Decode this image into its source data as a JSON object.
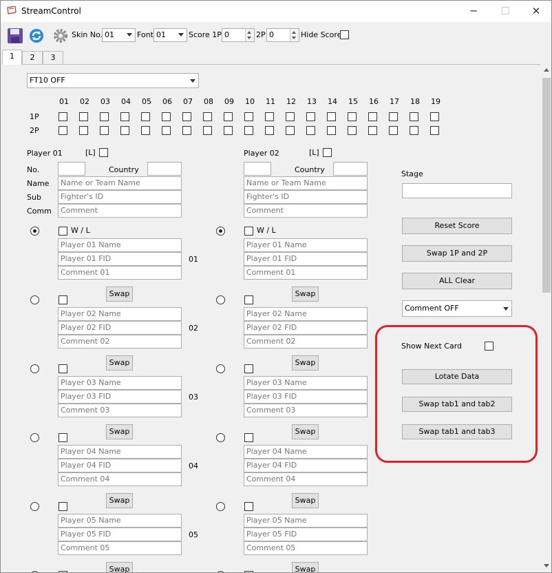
{
  "window": {
    "title": "StreamControl",
    "minimize": "─",
    "maximize": "☐",
    "close": "✕"
  },
  "toolbar": {
    "skin_label": "Skin No.",
    "skin_value": "01",
    "font_label": "Font",
    "font_value": "01",
    "score_label": "Score 1P",
    "score1": "0",
    "p2_label": "2P",
    "score2": "0",
    "hide_score_label": "Hide Score"
  },
  "tabs": [
    "1",
    "2",
    "3"
  ],
  "ft_select": "FT10 OFF",
  "round_columns": [
    "01",
    "02",
    "03",
    "04",
    "05",
    "06",
    "07",
    "08",
    "09",
    "10",
    "11",
    "12",
    "13",
    "14",
    "15",
    "16",
    "17",
    "18",
    "19"
  ],
  "row_labels": {
    "p1": "1P",
    "p2": "2P"
  },
  "players": [
    {
      "title": "Player 01",
      "l_label": "[L]",
      "no_label": "No.",
      "country_label": "Country",
      "name_label": "Name",
      "sub_label": "Sub",
      "comm_label": "Comm",
      "name_placeholder": "Name or Team Name",
      "sub_placeholder": "Fighter's ID",
      "comm_placeholder": "Comment"
    },
    {
      "title": "Player 02",
      "l_label": "[L]",
      "no_label": "",
      "country_label": "Country",
      "name_placeholder": "Name or Team Name",
      "sub_placeholder": "Fighter's ID",
      "comm_placeholder": "Comment"
    }
  ],
  "wl_label": "W / L",
  "swap_label": "Swap",
  "entries": [
    {
      "num": "01",
      "name": "Player 01 Name",
      "fid": "Player 01 FID",
      "comment": "Comment 01"
    },
    {
      "num": "02",
      "name": "Player 02 Name",
      "fid": "Player 02 FID",
      "comment": "Comment 02"
    },
    {
      "num": "03",
      "name": "Player 03 Name",
      "fid": "Player 03 FID",
      "comment": "Comment 03"
    },
    {
      "num": "04",
      "name": "Player 04 Name",
      "fid": "Player 04 FID",
      "comment": "Comment 04"
    },
    {
      "num": "05",
      "name": "Player 05 Name",
      "fid": "Player 05 FID",
      "comment": "Comment 05"
    }
  ],
  "right_panel": {
    "stage_label": "Stage",
    "reset_score": "Reset Score",
    "swap_1p_2p": "Swap 1P and 2P",
    "all_clear": "ALL Clear",
    "comment_select": "Comment OFF",
    "show_next_card": "Show Next Card",
    "lotate_data": "Lotate Data",
    "swap_tab12": "Swap tab1 and tab2",
    "swap_tab13": "Swap tab1 and tab3"
  },
  "colors": {
    "highlight": "#e0202a",
    "save_icon": "#6a4aa0",
    "refresh_icon": "#2a8ad4"
  }
}
